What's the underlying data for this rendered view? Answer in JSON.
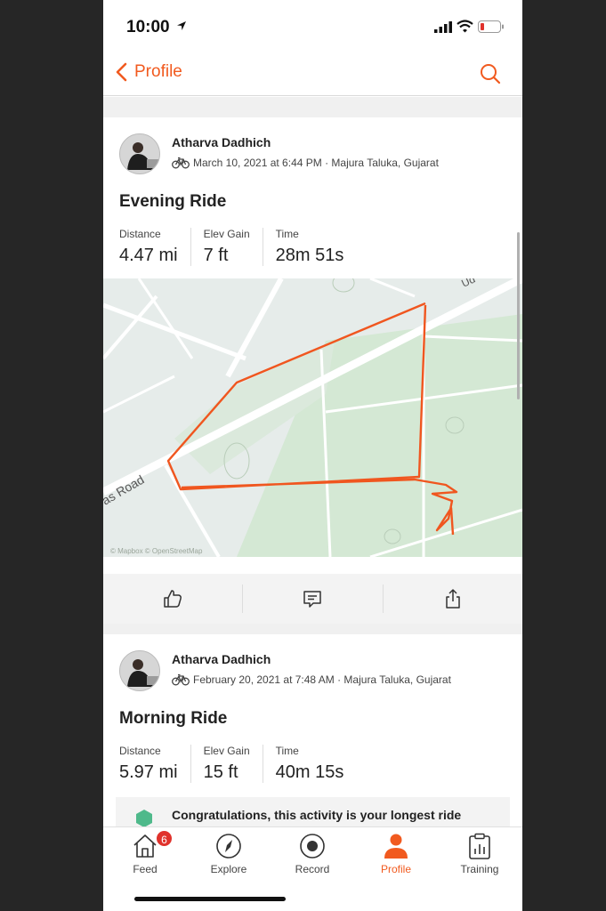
{
  "status": {
    "time": "10:00"
  },
  "nav": {
    "back_label": "Profile"
  },
  "activities": [
    {
      "athlete": "Atharva Dadhich",
      "meta": "March 10, 2021 at 6:44 PM · Majura Taluka, Gujarat",
      "title": "Evening Ride",
      "stats": [
        {
          "label": "Distance",
          "value": "4.47 mi"
        },
        {
          "label": "Elev Gain",
          "value": "7 ft"
        },
        {
          "label": "Time",
          "value": "28m 51s"
        }
      ],
      "map": {
        "road_label": "as Road",
        "road_label_2": "Ud",
        "attribution": "© Mapbox © OpenStreetMap"
      }
    },
    {
      "athlete": "Atharva Dadhich",
      "meta": "February 20, 2021 at 7:48 AM · Majura Taluka, Gujarat",
      "title": "Morning Ride",
      "stats": [
        {
          "label": "Distance",
          "value": "5.97 mi"
        },
        {
          "label": "Elev Gain",
          "value": "15 ft"
        },
        {
          "label": "Time",
          "value": "40m 15s"
        }
      ],
      "banner": "Congratulations, this activity is your longest ride"
    }
  ],
  "tabs": [
    {
      "label": "Feed",
      "badge": "6"
    },
    {
      "label": "Explore"
    },
    {
      "label": "Record"
    },
    {
      "label": "Profile"
    },
    {
      "label": "Training"
    }
  ],
  "colors": {
    "accent": "#f15a1f",
    "route": "#f0561f",
    "badge": "#e0322c",
    "map_bg": "#e6ecea",
    "park": "#d4e8d4"
  }
}
